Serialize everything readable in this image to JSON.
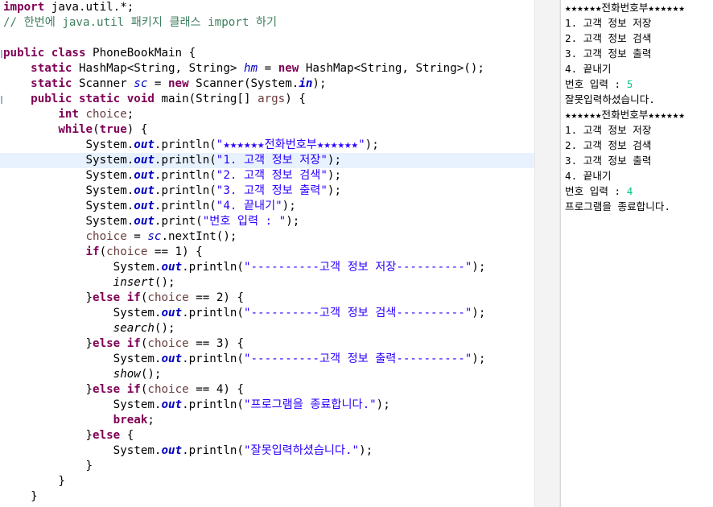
{
  "editor": {
    "lines": [
      {
        "indent": "",
        "tokens": [
          {
            "t": "import",
            "c": "k"
          },
          {
            "t": " java.util.*;",
            "c": ""
          }
        ]
      },
      {
        "indent": "",
        "tokens": [
          {
            "t": "// 한번에 java.util 패키지 클래스 import 하기",
            "c": "c"
          }
        ]
      },
      {
        "indent": "",
        "tokens": []
      },
      {
        "indent": "",
        "tokens": [
          {
            "t": "public",
            "c": "k"
          },
          {
            "t": " ",
            "c": ""
          },
          {
            "t": "class",
            "c": "k"
          },
          {
            "t": " PhoneBookMain {",
            "c": ""
          }
        ]
      },
      {
        "indent": "    ",
        "tokens": [
          {
            "t": "static",
            "c": "k"
          },
          {
            "t": " HashMap<String, String> ",
            "c": ""
          },
          {
            "t": "hm",
            "c": "f"
          },
          {
            "t": " = ",
            "c": ""
          },
          {
            "t": "new",
            "c": "k"
          },
          {
            "t": " HashMap<String, String>();",
            "c": ""
          }
        ]
      },
      {
        "indent": "    ",
        "tokens": [
          {
            "t": "static",
            "c": "k"
          },
          {
            "t": " Scanner ",
            "c": ""
          },
          {
            "t": "sc",
            "c": "f"
          },
          {
            "t": " = ",
            "c": ""
          },
          {
            "t": "new",
            "c": "k"
          },
          {
            "t": " Scanner(System.",
            "c": ""
          },
          {
            "t": "in",
            "c": "fb"
          },
          {
            "t": ");",
            "c": ""
          }
        ]
      },
      {
        "indent": "    ",
        "tokens": [
          {
            "t": "public",
            "c": "k"
          },
          {
            "t": " ",
            "c": ""
          },
          {
            "t": "static",
            "c": "k"
          },
          {
            "t": " ",
            "c": ""
          },
          {
            "t": "void",
            "c": "k"
          },
          {
            "t": " main(String[] ",
            "c": ""
          },
          {
            "t": "args",
            "c": "v"
          },
          {
            "t": ") {",
            "c": ""
          }
        ]
      },
      {
        "indent": "        ",
        "tokens": [
          {
            "t": "int",
            "c": "k"
          },
          {
            "t": " ",
            "c": ""
          },
          {
            "t": "choice",
            "c": "v"
          },
          {
            "t": ";",
            "c": ""
          }
        ]
      },
      {
        "indent": "        ",
        "tokens": [
          {
            "t": "while",
            "c": "k"
          },
          {
            "t": "(",
            "c": ""
          },
          {
            "t": "true",
            "c": "k"
          },
          {
            "t": ") {",
            "c": ""
          }
        ]
      },
      {
        "indent": "            ",
        "tokens": [
          {
            "t": "System.",
            "c": ""
          },
          {
            "t": "out",
            "c": "fb"
          },
          {
            "t": ".println(",
            "c": ""
          },
          {
            "t": "\"★★★★★★전화번호부★★★★★★\"",
            "c": "s"
          },
          {
            "t": ");",
            "c": ""
          }
        ]
      },
      {
        "indent": "            ",
        "highlight": true,
        "tokens": [
          {
            "t": "System.",
            "c": ""
          },
          {
            "t": "out",
            "c": "fb"
          },
          {
            "t": ".println(",
            "c": ""
          },
          {
            "t": "\"1. 고객 정보 저장\"",
            "c": "s"
          },
          {
            "t": ");",
            "c": ""
          }
        ]
      },
      {
        "indent": "            ",
        "tokens": [
          {
            "t": "System.",
            "c": ""
          },
          {
            "t": "out",
            "c": "fb"
          },
          {
            "t": ".println(",
            "c": ""
          },
          {
            "t": "\"2. 고객 정보 검색\"",
            "c": "s"
          },
          {
            "t": ");",
            "c": ""
          }
        ]
      },
      {
        "indent": "            ",
        "tokens": [
          {
            "t": "System.",
            "c": ""
          },
          {
            "t": "out",
            "c": "fb"
          },
          {
            "t": ".println(",
            "c": ""
          },
          {
            "t": "\"3. 고객 정보 출력\"",
            "c": "s"
          },
          {
            "t": ");",
            "c": ""
          }
        ]
      },
      {
        "indent": "            ",
        "tokens": [
          {
            "t": "System.",
            "c": ""
          },
          {
            "t": "out",
            "c": "fb"
          },
          {
            "t": ".println(",
            "c": ""
          },
          {
            "t": "\"4. 끝내기\"",
            "c": "s"
          },
          {
            "t": ");",
            "c": ""
          }
        ]
      },
      {
        "indent": "            ",
        "tokens": [
          {
            "t": "System.",
            "c": ""
          },
          {
            "t": "out",
            "c": "fb"
          },
          {
            "t": ".print(",
            "c": ""
          },
          {
            "t": "\"번호 입력 : \"",
            "c": "s"
          },
          {
            "t": ");",
            "c": ""
          }
        ]
      },
      {
        "indent": "            ",
        "tokens": [
          {
            "t": "choice",
            "c": "v"
          },
          {
            "t": " = ",
            "c": ""
          },
          {
            "t": "sc",
            "c": "f"
          },
          {
            "t": ".nextInt();",
            "c": ""
          }
        ]
      },
      {
        "indent": "            ",
        "tokens": [
          {
            "t": "if",
            "c": "k"
          },
          {
            "t": "(",
            "c": ""
          },
          {
            "t": "choice",
            "c": "v"
          },
          {
            "t": " == 1) {",
            "c": ""
          }
        ]
      },
      {
        "indent": "                ",
        "tokens": [
          {
            "t": "System.",
            "c": ""
          },
          {
            "t": "out",
            "c": "fb"
          },
          {
            "t": ".println(",
            "c": ""
          },
          {
            "t": "\"----------고객 정보 저장----------\"",
            "c": "s"
          },
          {
            "t": ");",
            "c": ""
          }
        ]
      },
      {
        "indent": "                ",
        "tokens": [
          {
            "t": "insert",
            "c": "m"
          },
          {
            "t": "();",
            "c": ""
          }
        ]
      },
      {
        "indent": "            ",
        "tokens": [
          {
            "t": "}",
            "c": ""
          },
          {
            "t": "else",
            "c": "k"
          },
          {
            "t": " ",
            "c": ""
          },
          {
            "t": "if",
            "c": "k"
          },
          {
            "t": "(",
            "c": ""
          },
          {
            "t": "choice",
            "c": "v"
          },
          {
            "t": " == 2) {",
            "c": ""
          }
        ]
      },
      {
        "indent": "                ",
        "tokens": [
          {
            "t": "System.",
            "c": ""
          },
          {
            "t": "out",
            "c": "fb"
          },
          {
            "t": ".println(",
            "c": ""
          },
          {
            "t": "\"----------고객 정보 검색----------\"",
            "c": "s"
          },
          {
            "t": ");",
            "c": ""
          }
        ]
      },
      {
        "indent": "                ",
        "tokens": [
          {
            "t": "search",
            "c": "m"
          },
          {
            "t": "();",
            "c": ""
          }
        ]
      },
      {
        "indent": "            ",
        "tokens": [
          {
            "t": "}",
            "c": ""
          },
          {
            "t": "else",
            "c": "k"
          },
          {
            "t": " ",
            "c": ""
          },
          {
            "t": "if",
            "c": "k"
          },
          {
            "t": "(",
            "c": ""
          },
          {
            "t": "choice",
            "c": "v"
          },
          {
            "t": " == 3) {",
            "c": ""
          }
        ]
      },
      {
        "indent": "                ",
        "tokens": [
          {
            "t": "System.",
            "c": ""
          },
          {
            "t": "out",
            "c": "fb"
          },
          {
            "t": ".println(",
            "c": ""
          },
          {
            "t": "\"----------고객 정보 출력----------\"",
            "c": "s"
          },
          {
            "t": ");",
            "c": ""
          }
        ]
      },
      {
        "indent": "                ",
        "tokens": [
          {
            "t": "show",
            "c": "m"
          },
          {
            "t": "();",
            "c": ""
          }
        ]
      },
      {
        "indent": "            ",
        "tokens": [
          {
            "t": "}",
            "c": ""
          },
          {
            "t": "else",
            "c": "k"
          },
          {
            "t": " ",
            "c": ""
          },
          {
            "t": "if",
            "c": "k"
          },
          {
            "t": "(",
            "c": ""
          },
          {
            "t": "choice",
            "c": "v"
          },
          {
            "t": " == 4) {",
            "c": ""
          }
        ]
      },
      {
        "indent": "                ",
        "tokens": [
          {
            "t": "System.",
            "c": ""
          },
          {
            "t": "out",
            "c": "fb"
          },
          {
            "t": ".println(",
            "c": ""
          },
          {
            "t": "\"프로그램을 종료합니다.\"",
            "c": "s"
          },
          {
            "t": ");",
            "c": ""
          }
        ]
      },
      {
        "indent": "                ",
        "tokens": [
          {
            "t": "break",
            "c": "k"
          },
          {
            "t": ";",
            "c": ""
          }
        ]
      },
      {
        "indent": "            ",
        "tokens": [
          {
            "t": "}",
            "c": ""
          },
          {
            "t": "else",
            "c": "k"
          },
          {
            "t": " {",
            "c": ""
          }
        ]
      },
      {
        "indent": "                ",
        "tokens": [
          {
            "t": "System.",
            "c": ""
          },
          {
            "t": "out",
            "c": "fb"
          },
          {
            "t": ".println(",
            "c": ""
          },
          {
            "t": "\"잘못입력하셨습니다.\"",
            "c": "s"
          },
          {
            "t": ");",
            "c": ""
          }
        ]
      },
      {
        "indent": "            ",
        "tokens": [
          {
            "t": "}",
            "c": ""
          }
        ]
      },
      {
        "indent": "        ",
        "tokens": [
          {
            "t": "}",
            "c": ""
          }
        ]
      },
      {
        "indent": "    ",
        "tokens": [
          {
            "t": "}",
            "c": ""
          }
        ]
      }
    ]
  },
  "console": {
    "lines": [
      {
        "text": "★★★★★★전화번호부★★★★★★"
      },
      {
        "text": "1. 고객 정보 저장"
      },
      {
        "text": "2. 고객 정보 검색"
      },
      {
        "text": "3. 고객 정보 출력"
      },
      {
        "text": "4. 끝내기"
      },
      {
        "text": "번호 입력 : ",
        "input": "5"
      },
      {
        "text": "잘못입력하셨습니다."
      },
      {
        "text": "★★★★★★전화번호부★★★★★★"
      },
      {
        "text": "1. 고객 정보 저장"
      },
      {
        "text": "2. 고객 정보 검색"
      },
      {
        "text": "3. 고객 정보 출력"
      },
      {
        "text": "4. 끝내기"
      },
      {
        "text": "번호 입력 : ",
        "input": "4"
      },
      {
        "text": "프로그램을 종료합니다."
      }
    ],
    "input_color": "#00c87d"
  },
  "colors": {
    "keyword": "#7f0055",
    "string": "#2a00ff",
    "comment": "#3f7f5f",
    "field": "#0000c0",
    "local_variable": "#6a3e3e",
    "current_line_highlight": "#e8f2fe"
  }
}
